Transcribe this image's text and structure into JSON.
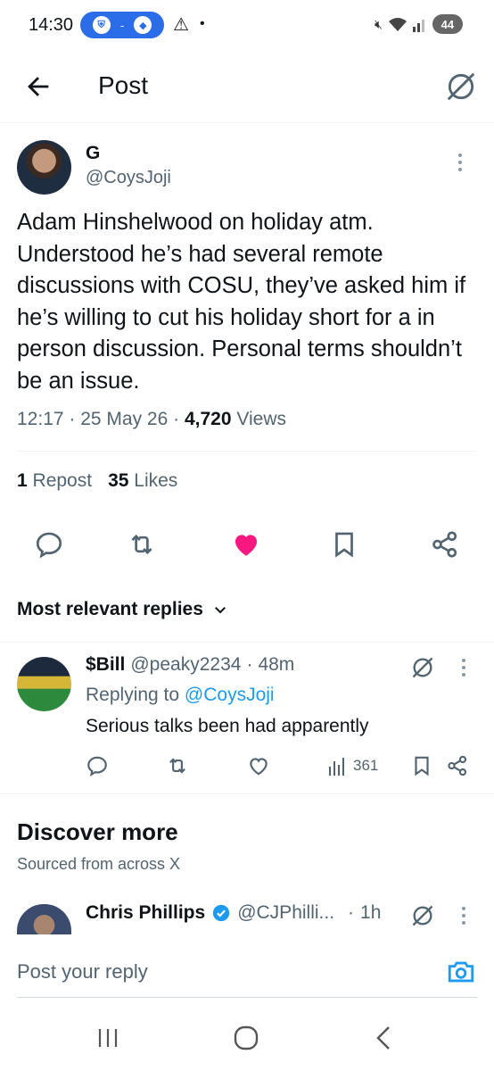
{
  "status_bar": {
    "time": "14:30",
    "battery": "44",
    "pill_dash": "-"
  },
  "header": {
    "title": "Post"
  },
  "post": {
    "author_name": "G",
    "author_handle": "@CoysJoji",
    "text": "Adam Hinshelwood on holiday atm. Understood he’s had several remote discussions with COSU, they’ve asked him if he’s willing to cut his holiday short for a in person discussion.  Personal terms shouldn’t be an issue.",
    "time": "12:17",
    "date": "25 May 26",
    "views_count": "4,720",
    "views_label": "Views",
    "reposts_count": "1",
    "reposts_label": "Repost",
    "likes_count": "35",
    "likes_label": "Likes",
    "liked": true
  },
  "replies_header": {
    "label": "Most relevant replies"
  },
  "reply": {
    "name": "$Bill",
    "handle": "@peaky2234",
    "time": "48m",
    "replying_prefix": "Replying to",
    "replying_to": "@CoysJoji",
    "text": "Serious talks been had apparently",
    "views": "361"
  },
  "discover": {
    "title": "Discover more",
    "subtitle": "Sourced from across X",
    "post": {
      "name": "Chris Phillips",
      "handle": "@CJPhilli...",
      "time": "1h",
      "verified": true
    }
  },
  "composer": {
    "placeholder": "Post your reply"
  },
  "colors": {
    "accent": "#1d9bf0",
    "like": "#f91880",
    "text": "#0f1419",
    "muted": "#536471"
  },
  "icons": [
    "back-arrow-icon",
    "grok-icon",
    "more-icon",
    "reply-icon",
    "repost-icon",
    "heart-icon",
    "bookmark-icon",
    "share-icon",
    "views-icon",
    "chevron-down-icon",
    "verified-icon",
    "camera-icon",
    "recent-apps-icon",
    "home-icon",
    "nav-back-icon"
  ]
}
